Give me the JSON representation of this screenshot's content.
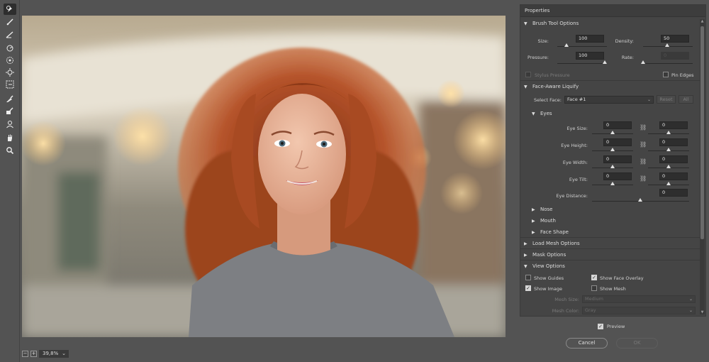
{
  "panel": {
    "title": "Properties"
  },
  "brush": {
    "title": "Brush Tool Options",
    "size_label": "Size:",
    "size": "100",
    "density_label": "Density:",
    "density": "50",
    "pressure_label": "Pressure:",
    "pressure": "100",
    "rate_label": "Rate:",
    "rate": "0",
    "stylus_label": "Stylus Pressure",
    "pin_label": "Pin Edges"
  },
  "face": {
    "title": "Face-Aware Liquify",
    "select_label": "Select Face:",
    "select_value": "Face #1",
    "reset_label": "Reset",
    "all_label": "All",
    "eyes": {
      "title": "Eyes",
      "size_label": "Eye Size:",
      "size_l": "0",
      "size_r": "0",
      "height_label": "Eye Height:",
      "height_l": "0",
      "height_r": "0",
      "width_label": "Eye Width:",
      "width_l": "0",
      "width_r": "0",
      "tilt_label": "Eye Tilt:",
      "tilt_l": "0",
      "tilt_r": "0",
      "distance_label": "Eye Distance:",
      "distance": "0"
    },
    "nose": "Nose",
    "mouth": "Mouth",
    "face_shape": "Face Shape"
  },
  "load_mesh": "Load Mesh Options",
  "mask": "Mask Options",
  "view": {
    "title": "View Options",
    "show_guides": "Show Guides",
    "show_face_overlay": "Show Face Overlay",
    "show_image": "Show Image",
    "show_mesh": "Show Mesh",
    "mesh_size_label": "Mesh Size:",
    "mesh_size": "Medium",
    "mesh_color_label": "Mesh Color:",
    "mesh_color": "Gray"
  },
  "preview_label": "Preview",
  "cancel_label": "Cancel",
  "ok_label": "OK",
  "zoom": {
    "value": "39,8%",
    "minus": "−",
    "plus": "+"
  },
  "tools": [
    "forward-warp-icon",
    "reconstruct-icon",
    "smooth-icon",
    "twirl-icon",
    "pucker-icon",
    "bloat-icon",
    "push-left-icon",
    "freeze-mask-icon",
    "thaw-mask-icon",
    "face-tool-icon",
    "hand-icon",
    "zoom-icon"
  ],
  "colors": {
    "panel_bg": "#454545",
    "ui_bg": "#535353",
    "hair": "#b5532a"
  }
}
